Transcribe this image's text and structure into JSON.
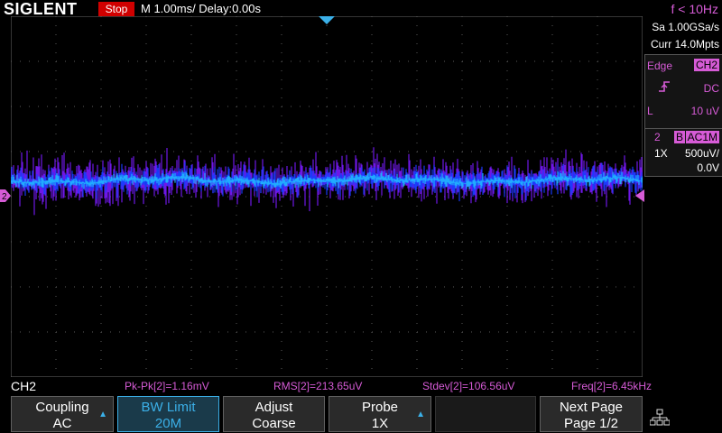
{
  "header": {
    "logo": "SIGLENT",
    "run_status": "Stop",
    "timebase": "M 1.00ms/ Delay:0.00s",
    "freq_counter": "f < 10Hz"
  },
  "acquisition": {
    "sample_rate": "Sa 1.00GSa/s",
    "memory_depth": "Curr 14.0Mpts"
  },
  "trigger": {
    "type": "Edge",
    "source": "CH2",
    "slope_icon": "rising-edge-icon",
    "coupling": "DC",
    "level_prefix": "L",
    "level": "10 uV"
  },
  "channel": {
    "number": "2",
    "bw_badge": "B",
    "coupling_badge": "AC1M",
    "probe": "1X",
    "scale": "500uV/",
    "offset": "0.0V",
    "marker": "2"
  },
  "measurements": {
    "channel_label": "CH2",
    "pkpk": "Pk-Pk[2]=1.16mV",
    "rms": "RMS[2]=213.65uV",
    "stdev": "Stdev[2]=106.56uV",
    "freq": "Freq[2]=6.45kHz"
  },
  "menu": {
    "coupling_label": "Coupling",
    "coupling_value": "AC",
    "bwlimit_label": "BW Limit",
    "bwlimit_value": "20M",
    "adjust_label": "Adjust",
    "adjust_value": "Coarse",
    "probe_label": "Probe",
    "probe_value": "1X",
    "nextpage_label": "Next Page",
    "nextpage_value": "Page 1/2"
  },
  "colors": {
    "trace_core": "#21b8ff",
    "trace_mid": "#1a3cff",
    "trace_outer": "#7a1aff",
    "accent_magenta": "#d65bd6",
    "accent_cyan": "#3bb0e8",
    "stop_red": "#d00000"
  }
}
